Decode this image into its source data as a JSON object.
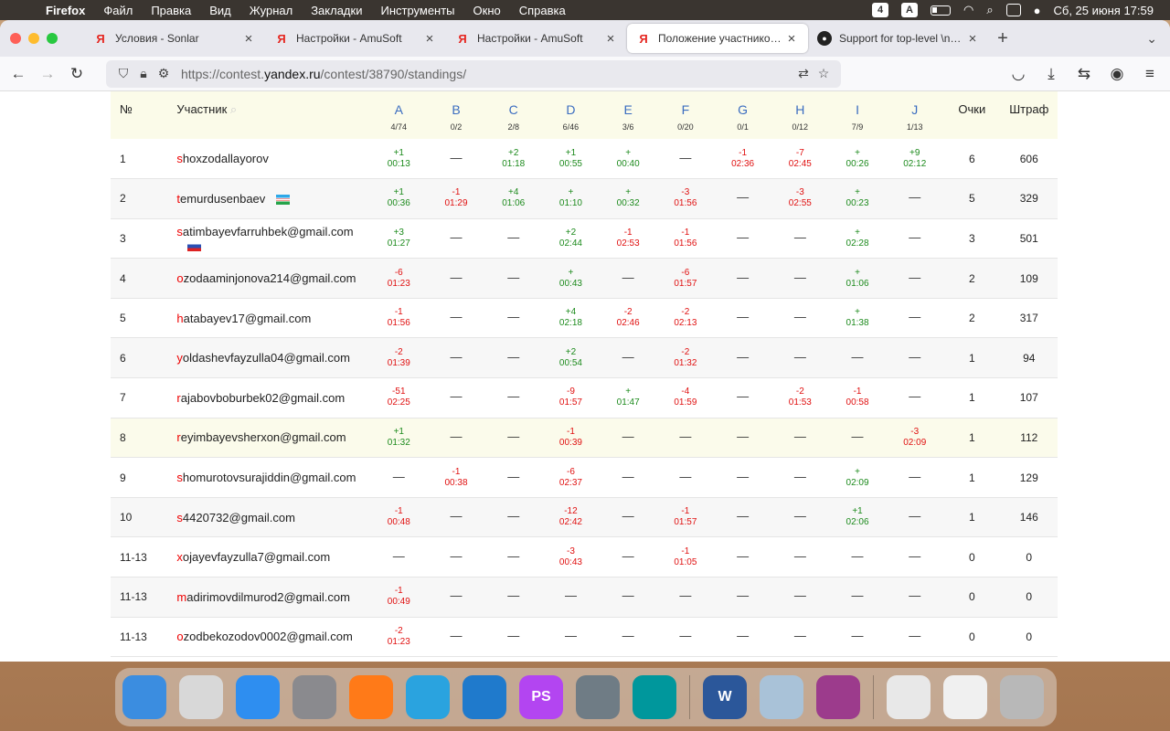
{
  "menubar": {
    "app": "Firefox",
    "items": [
      "Файл",
      "Правка",
      "Вид",
      "Журнал",
      "Закладки",
      "Инструменты",
      "Окно",
      "Справка"
    ],
    "clock": "Сб, 25 июня  17:59",
    "badge": "4"
  },
  "tabs": [
    {
      "title": "Условия - Sonlar",
      "icon": "Я"
    },
    {
      "title": "Настройки - AmuSoft",
      "icon": "Я"
    },
    {
      "title": "Настройки - AmuSoft",
      "icon": "Я"
    },
    {
      "title": "Положение участников — Amu",
      "icon": "Я"
    },
    {
      "title": "Support for top-level \\newline a",
      "icon": "github"
    }
  ],
  "url": {
    "prefix": "https://contest.",
    "domain": "yandex.ru",
    "path": "/contest/38790/standings/"
  },
  "table": {
    "headers": {
      "num": "№",
      "name": "Участник",
      "points": "Очки",
      "penalty": "Штраф"
    },
    "problems": [
      {
        "letter": "A",
        "stat": "4/74"
      },
      {
        "letter": "B",
        "stat": "0/2"
      },
      {
        "letter": "C",
        "stat": "2/8"
      },
      {
        "letter": "D",
        "stat": "6/46"
      },
      {
        "letter": "E",
        "stat": "3/6"
      },
      {
        "letter": "F",
        "stat": "0/20"
      },
      {
        "letter": "G",
        "stat": "0/1"
      },
      {
        "letter": "H",
        "stat": "0/12"
      },
      {
        "letter": "I",
        "stat": "7/9"
      },
      {
        "letter": "J",
        "stat": "1/13"
      }
    ],
    "rows": [
      {
        "num": "1",
        "first": "s",
        "rest": "hoxzodallayorov",
        "flag": "",
        "points": "6",
        "penalty": "606",
        "cells": [
          [
            "+1",
            "00:13"
          ],
          [
            "—",
            ""
          ],
          [
            "+2",
            "01:18"
          ],
          [
            "+1",
            "00:55"
          ],
          [
            "+",
            "00:40"
          ],
          [
            "—",
            ""
          ],
          [
            "-1",
            "02:36"
          ],
          [
            "-7",
            "02:45"
          ],
          [
            "+",
            "00:26"
          ],
          [
            "+9",
            "02:12"
          ]
        ]
      },
      {
        "num": "2",
        "first": "t",
        "rest": "emurdusenbaev",
        "flag": "uz",
        "points": "5",
        "penalty": "329",
        "cells": [
          [
            "+1",
            "00:36"
          ],
          [
            "-1",
            "01:29"
          ],
          [
            "+4",
            "01:06"
          ],
          [
            "+",
            "01:10"
          ],
          [
            "+",
            "00:32"
          ],
          [
            "-3",
            "01:56"
          ],
          [
            "—",
            ""
          ],
          [
            "-3",
            "02:55"
          ],
          [
            "+",
            "00:23"
          ],
          [
            "—",
            ""
          ]
        ]
      },
      {
        "num": "3",
        "first": "s",
        "rest": "atimbayevfarruhbek@gmail.com",
        "flag": "ru",
        "points": "3",
        "penalty": "501",
        "cells": [
          [
            "+3",
            "01:27"
          ],
          [
            "—",
            ""
          ],
          [
            "—",
            ""
          ],
          [
            "+2",
            "02:44"
          ],
          [
            "-1",
            "02:53"
          ],
          [
            "-1",
            "01:56"
          ],
          [
            "—",
            ""
          ],
          [
            "—",
            ""
          ],
          [
            "+",
            "02:28"
          ],
          [
            "—",
            ""
          ]
        ]
      },
      {
        "num": "4",
        "first": "o",
        "rest": "zodaaminjonova214@gmail.com",
        "flag": "",
        "points": "2",
        "penalty": "109",
        "cells": [
          [
            "-6",
            "01:23"
          ],
          [
            "—",
            ""
          ],
          [
            "—",
            ""
          ],
          [
            "+",
            "00:43"
          ],
          [
            "—",
            ""
          ],
          [
            "-6",
            "01:57"
          ],
          [
            "—",
            ""
          ],
          [
            "—",
            ""
          ],
          [
            "+",
            "01:06"
          ],
          [
            "—",
            ""
          ]
        ]
      },
      {
        "num": "5",
        "first": "h",
        "rest": "atabayev17@gmail.com",
        "flag": "",
        "points": "2",
        "penalty": "317",
        "cells": [
          [
            "-1",
            "01:56"
          ],
          [
            "—",
            ""
          ],
          [
            "—",
            ""
          ],
          [
            "+4",
            "02:18"
          ],
          [
            "-2",
            "02:46"
          ],
          [
            "-2",
            "02:13"
          ],
          [
            "—",
            ""
          ],
          [
            "—",
            ""
          ],
          [
            "+",
            "01:38"
          ],
          [
            "—",
            ""
          ]
        ]
      },
      {
        "num": "6",
        "first": "y",
        "rest": "oldashevfayzulla04@gmail.com",
        "flag": "",
        "points": "1",
        "penalty": "94",
        "cells": [
          [
            "-2",
            "01:39"
          ],
          [
            "—",
            ""
          ],
          [
            "—",
            ""
          ],
          [
            "+2",
            "00:54"
          ],
          [
            "—",
            ""
          ],
          [
            "-2",
            "01:32"
          ],
          [
            "—",
            ""
          ],
          [
            "—",
            ""
          ],
          [
            "—",
            ""
          ],
          [
            "—",
            ""
          ]
        ]
      },
      {
        "num": "7",
        "first": "r",
        "rest": "ajabovboburbek02@gmail.com",
        "flag": "",
        "points": "1",
        "penalty": "107",
        "cells": [
          [
            "-51",
            "02:25"
          ],
          [
            "—",
            ""
          ],
          [
            "—",
            ""
          ],
          [
            "-9",
            "01:57"
          ],
          [
            "+",
            "01:47"
          ],
          [
            "-4",
            "01:59"
          ],
          [
            "—",
            ""
          ],
          [
            "-2",
            "01:53"
          ],
          [
            "-1",
            "00:58"
          ],
          [
            "—",
            ""
          ]
        ]
      },
      {
        "num": "8",
        "first": "r",
        "rest": "eyimbayevsherxon@gmail.com",
        "flag": "",
        "points": "1",
        "penalty": "112",
        "cells": [
          [
            "+1",
            "01:32"
          ],
          [
            "—",
            ""
          ],
          [
            "—",
            ""
          ],
          [
            "-1",
            "00:39"
          ],
          [
            "—",
            ""
          ],
          [
            "—",
            ""
          ],
          [
            "—",
            ""
          ],
          [
            "—",
            ""
          ],
          [
            "—",
            ""
          ],
          [
            "-3",
            "02:09"
          ]
        ]
      },
      {
        "num": "9",
        "first": "s",
        "rest": "homurotovsurajiddin@gmail.com",
        "flag": "",
        "points": "1",
        "penalty": "129",
        "cells": [
          [
            "—",
            ""
          ],
          [
            "-1",
            "00:38"
          ],
          [
            "—",
            ""
          ],
          [
            "-6",
            "02:37"
          ],
          [
            "—",
            ""
          ],
          [
            "—",
            ""
          ],
          [
            "—",
            ""
          ],
          [
            "—",
            ""
          ],
          [
            "+",
            "02:09"
          ],
          [
            "—",
            ""
          ]
        ]
      },
      {
        "num": "10",
        "first": "s",
        "rest": "4420732@gmail.com",
        "flag": "",
        "points": "1",
        "penalty": "146",
        "cells": [
          [
            "-1",
            "00:48"
          ],
          [
            "—",
            ""
          ],
          [
            "—",
            ""
          ],
          [
            "-12",
            "02:42"
          ],
          [
            "—",
            ""
          ],
          [
            "-1",
            "01:57"
          ],
          [
            "—",
            ""
          ],
          [
            "—",
            ""
          ],
          [
            "+1",
            "02:06"
          ],
          [
            "—",
            ""
          ]
        ]
      },
      {
        "num": "11-13",
        "first": "x",
        "rest": "ojayevfayzulla7@gmail.com",
        "flag": "",
        "points": "0",
        "penalty": "0",
        "cells": [
          [
            "—",
            ""
          ],
          [
            "—",
            ""
          ],
          [
            "—",
            ""
          ],
          [
            "-3",
            "00:43"
          ],
          [
            "—",
            ""
          ],
          [
            "-1",
            "01:05"
          ],
          [
            "—",
            ""
          ],
          [
            "—",
            ""
          ],
          [
            "—",
            ""
          ],
          [
            "—",
            ""
          ]
        ]
      },
      {
        "num": "11-13",
        "first": "m",
        "rest": "adirimovdilmurod2@gmail.com",
        "flag": "",
        "points": "0",
        "penalty": "0",
        "cells": [
          [
            "-1",
            "00:49"
          ],
          [
            "—",
            ""
          ],
          [
            "—",
            ""
          ],
          [
            "—",
            ""
          ],
          [
            "—",
            ""
          ],
          [
            "—",
            ""
          ],
          [
            "—",
            ""
          ],
          [
            "—",
            ""
          ],
          [
            "—",
            ""
          ],
          [
            "—",
            ""
          ]
        ]
      },
      {
        "num": "11-13",
        "first": "o",
        "rest": "zodbekozodov0002@gmail.com",
        "flag": "",
        "points": "0",
        "penalty": "0",
        "cells": [
          [
            "-2",
            "01:23"
          ],
          [
            "—",
            ""
          ],
          [
            "—",
            ""
          ],
          [
            "—",
            ""
          ],
          [
            "—",
            ""
          ],
          [
            "—",
            ""
          ],
          [
            "—",
            ""
          ],
          [
            "—",
            ""
          ],
          [
            "—",
            ""
          ],
          [
            "—",
            ""
          ]
        ]
      }
    ]
  },
  "dock": [
    {
      "name": "finder",
      "label": "",
      "color": "#3b8de0"
    },
    {
      "name": "launchpad",
      "label": "",
      "color": "#d8d8d8"
    },
    {
      "name": "safari",
      "label": "",
      "color": "#2e8ef0"
    },
    {
      "name": "system-preferences",
      "label": "",
      "color": "#8a8a8e"
    },
    {
      "name": "firefox",
      "label": "",
      "color": "#ff7a18"
    },
    {
      "name": "telegram",
      "label": "",
      "color": "#2aa3df"
    },
    {
      "name": "vscode",
      "label": "",
      "color": "#1f7acc"
    },
    {
      "name": "phpstorm",
      "label": "PS",
      "color": "#b345f1"
    },
    {
      "name": "sequel",
      "label": "",
      "color": "#6f7c85"
    },
    {
      "name": "arduino",
      "label": "",
      "color": "#00979c"
    },
    {
      "name": "word",
      "label": "W",
      "color": "#2b579a"
    },
    {
      "name": "preview",
      "label": "",
      "color": "#a9c2d8"
    },
    {
      "name": "winrar",
      "label": "",
      "color": "#9c3b8c"
    },
    {
      "name": "doc-window-1",
      "label": "",
      "color": "#e8e8e8"
    },
    {
      "name": "doc-window-2",
      "label": "",
      "color": "#f0f0f0"
    },
    {
      "name": "trash",
      "label": "",
      "color": "#b8b8b8"
    }
  ]
}
